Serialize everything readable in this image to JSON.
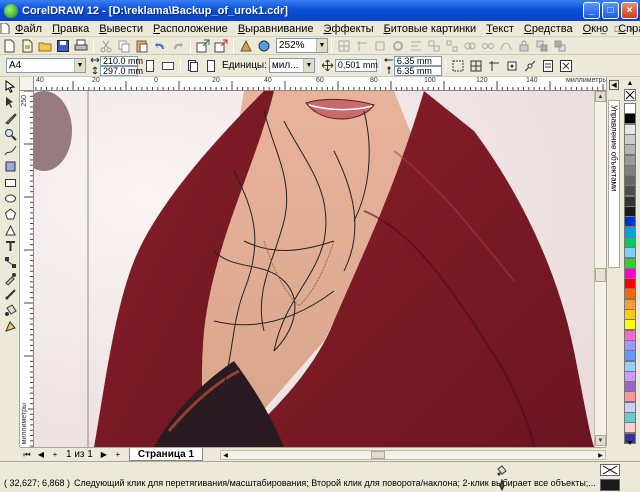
{
  "app": {
    "title": "CorelDRAW 12 - [D:\\reklama\\Backup_of_urok1.cdr]"
  },
  "window_buttons": {
    "minimize": "_",
    "maximize": "□",
    "close": "×"
  },
  "menu": {
    "items": [
      {
        "label": "Файл",
        "accel": "Ф",
        "rest": "айл"
      },
      {
        "label": "Правка",
        "accel": "П",
        "rest": "равка"
      },
      {
        "label": "Вывести",
        "accel": "В",
        "rest": "ывести"
      },
      {
        "label": "Расположение",
        "accel": "Р",
        "rest": "асположение"
      },
      {
        "label": "Выравнивание",
        "accel": "В",
        "rest": "ыравнивание"
      },
      {
        "label": "Эффекты",
        "accel": "Э",
        "rest": "ффекты"
      },
      {
        "label": "Битовые картинки",
        "accel": "Б",
        "rest": "итовые картинки"
      },
      {
        "label": "Текст",
        "accel": "Т",
        "rest": "екст"
      },
      {
        "label": "Средства",
        "accel": "С",
        "rest": "редства"
      },
      {
        "label": "Окно",
        "accel": "О",
        "rest": "кно"
      },
      {
        "label": "Справка",
        "accel": "С",
        "rest": "правка"
      }
    ]
  },
  "standard_toolbar": {
    "zoom_value": "252%"
  },
  "property_bar": {
    "page_size": "A4",
    "width": "210.0 mm",
    "height": "297.0 mm",
    "units_label": "Единицы:",
    "units_value": "мил...",
    "nudge": "0,501 mm",
    "dup_x": "6.35 mm",
    "dup_y": "6.35 mm"
  },
  "rulers": {
    "h_ticks": [
      "40",
      "20",
      "0",
      "20",
      "40",
      "60",
      "80",
      "100",
      "120",
      "140"
    ],
    "h_unit": "миллиметры",
    "v_unit": "миллиметры",
    "v_ticks": [
      "250"
    ]
  },
  "docker": {
    "tab_label": "Управление объектами"
  },
  "palette": {
    "colors": [
      "#ffffff",
      "#000000",
      "#e6e6e6",
      "#cccccc",
      "#b3b3b3",
      "#999999",
      "#808080",
      "#666666",
      "#4d4d4d",
      "#333333",
      "#1a1a1a",
      "#0033cc",
      "#00a0e6",
      "#00cc66",
      "#7ad0ff",
      "#33cc33",
      "#ff00cc",
      "#ff0000",
      "#ff6600",
      "#ff9933",
      "#ffcc00",
      "#ffff00",
      "#ff66cc",
      "#9999ff",
      "#6699ff",
      "#99ccff",
      "#cc99ff",
      "#9966cc",
      "#ff9999",
      "#ccccff",
      "#66cccc",
      "#ffcccc",
      "#333399"
    ]
  },
  "page_nav": {
    "count": "1 из 1",
    "tab": "Страница 1"
  },
  "status": {
    "coords": "( 32,627; 6,868 )",
    "hint": "Следующий клик для перетягивания/масштабирования; Второй клик для поворота/наклона; 2-клик выбирает все объекты;..."
  }
}
